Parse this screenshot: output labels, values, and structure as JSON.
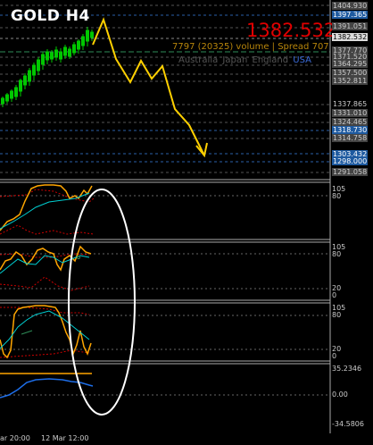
{
  "title": "GOLD  H4",
  "big_price": "1382.532",
  "info_line": "7797 (20325) volume | Spread 707",
  "sessions": [
    {
      "label": "Australia",
      "color": "#555555"
    },
    {
      "label": "Japan",
      "color": "#555555"
    },
    {
      "label": "England",
      "color": "#555555"
    },
    {
      "label": "USA",
      "color": "#3a6bd8"
    }
  ],
  "price_labels": [
    {
      "text": "1404.930",
      "bg": "#444444",
      "fg": "#cccccc"
    },
    {
      "text": "1397.365",
      "bg": "#1e5aa0",
      "fg": "#ffffff"
    },
    {
      "text": "1391.051",
      "bg": "#444444",
      "fg": "#cccccc"
    },
    {
      "text": "1382.532",
      "bg": "#dddddd",
      "fg": "#000000"
    },
    {
      "text": "1377.770",
      "bg": "#444444",
      "fg": "#cccccc"
    },
    {
      "text": "1371.520",
      "bg": "#444444",
      "fg": "#cccccc"
    },
    {
      "text": "1364.295",
      "bg": "#444444",
      "fg": "#cccccc"
    },
    {
      "text": "1357.500",
      "bg": "#444444",
      "fg": "#cccccc"
    },
    {
      "text": "1352.811",
      "bg": "#444444",
      "fg": "#cccccc"
    },
    {
      "text": "1337.865",
      "bg": "#000000",
      "fg": "#cccccc"
    },
    {
      "text": "1331.010",
      "bg": "#444444",
      "fg": "#cccccc"
    },
    {
      "text": "1324.465",
      "bg": "#444444",
      "fg": "#cccccc"
    },
    {
      "text": "1318.730",
      "bg": "#1e5aa0",
      "fg": "#ffffff"
    },
    {
      "text": "1314.758",
      "bg": "#444444",
      "fg": "#cccccc"
    },
    {
      "text": "1303.432",
      "bg": "#1e5aa0",
      "fg": "#ffffff"
    },
    {
      "text": "1298.000",
      "bg": "#1e5aa0",
      "fg": "#ffffff"
    },
    {
      "text": "1291.058",
      "bg": "#444444",
      "fg": "#cccccc"
    }
  ],
  "indicators": [
    {
      "name": "stochastic-1",
      "levels": [
        "105",
        "80"
      ]
    },
    {
      "name": "stochastic-2",
      "levels": [
        "105",
        "80",
        "20",
        "0"
      ]
    },
    {
      "name": "stochastic-3",
      "levels": [
        "105",
        "80",
        "20",
        "0"
      ]
    },
    {
      "name": "oscillator",
      "levels": [
        "35.2346",
        "0.00",
        "-34.5806"
      ]
    }
  ],
  "time_labels": [
    "ar 20:00",
    "12 Mar 12:00"
  ],
  "colors": {
    "background": "#000000",
    "bull_candle": "#00c800",
    "forecast_arrow": "#ffd000",
    "indicator_main": "#ffa500",
    "indicator_signal": "#00ced1",
    "indicator_band": "#cc0000",
    "oscillator_line": "#1e6ee8",
    "annotation_ellipse": "#ffffff"
  }
}
